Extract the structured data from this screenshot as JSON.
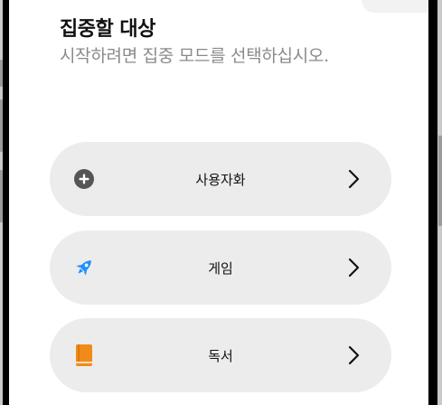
{
  "header": {
    "title": "집중할 대상",
    "subtitle": "시작하려면 집중 모드를 선택하십시오."
  },
  "modes": [
    {
      "label": "사용자화",
      "icon": "plus-circle-icon",
      "icon_color": "#555555"
    },
    {
      "label": "게임",
      "icon": "rocket-icon",
      "icon_color": "#1e90ff"
    },
    {
      "label": "독서",
      "icon": "book-icon",
      "icon_color": "#f28a1a"
    }
  ],
  "colors": {
    "row_background": "#ececec",
    "subtitle": "#8a8a8e"
  }
}
